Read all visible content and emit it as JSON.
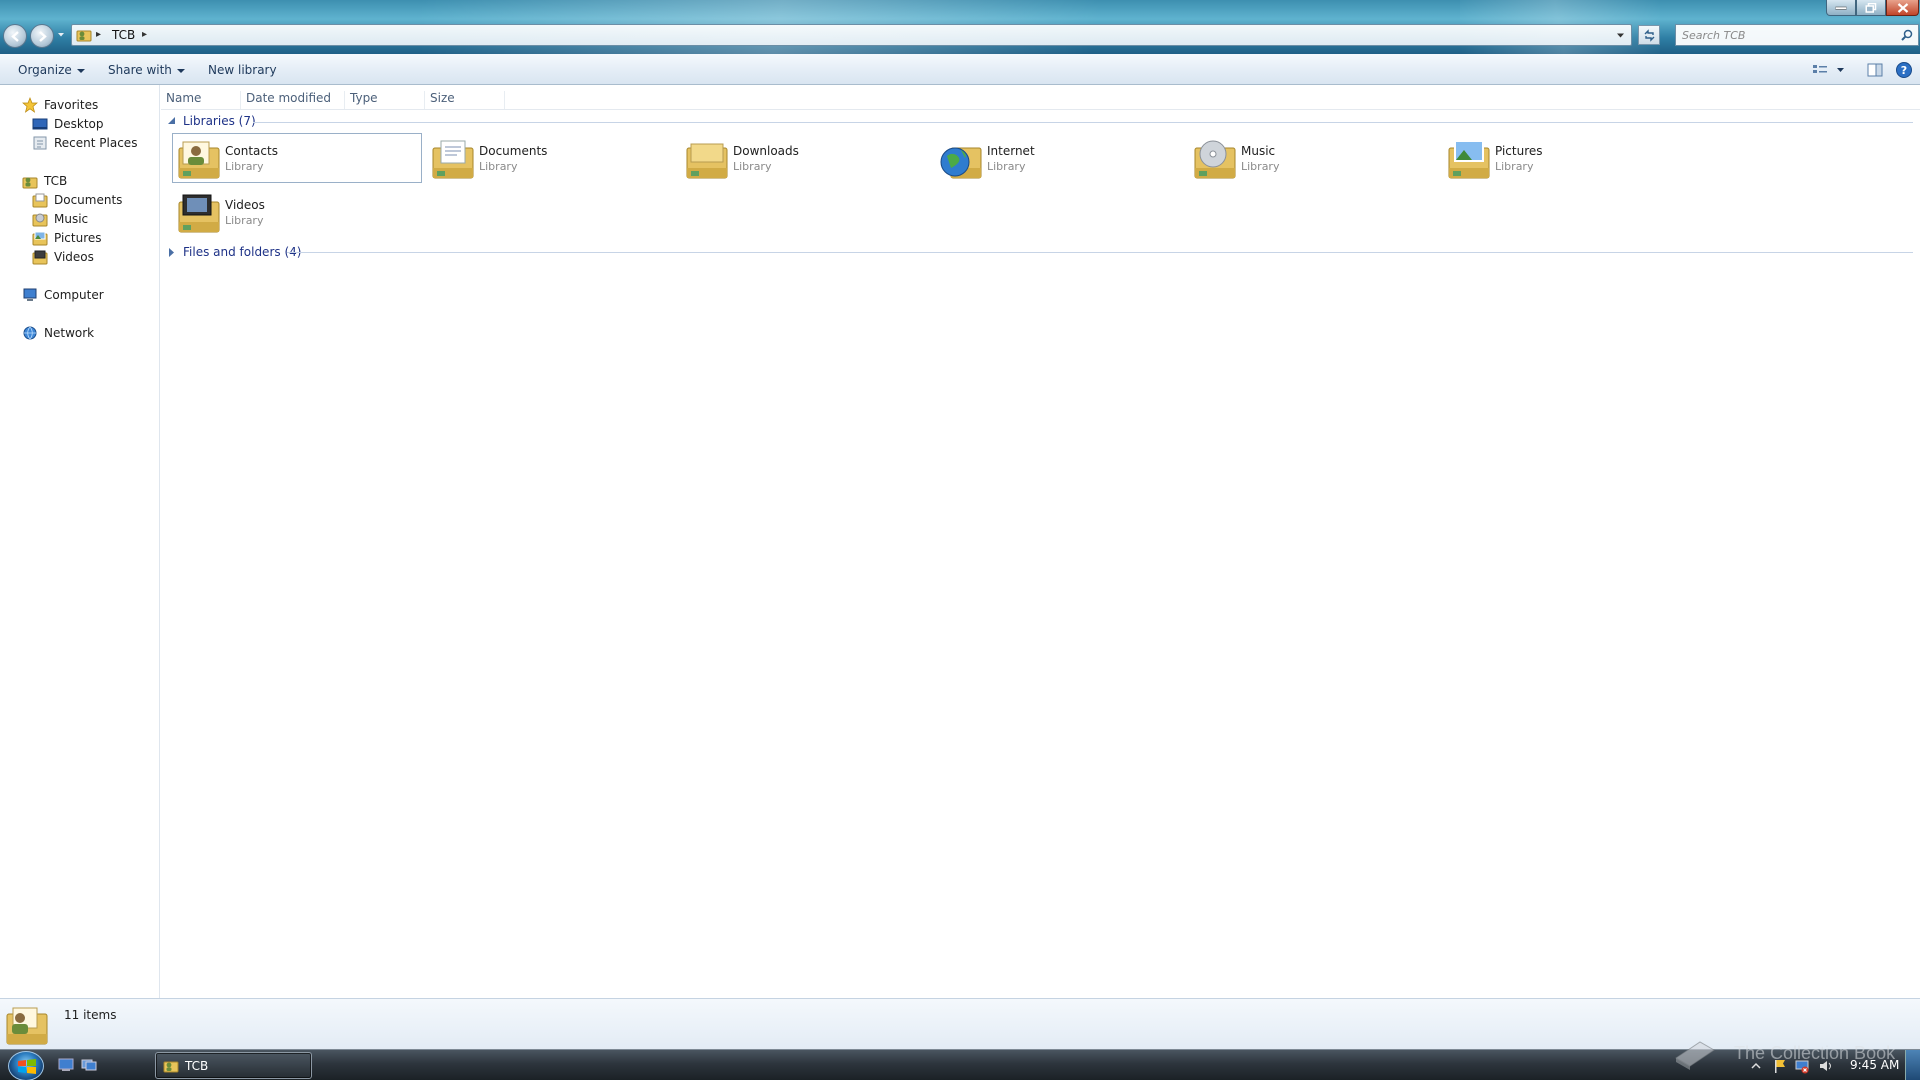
{
  "window": {
    "address": {
      "crumb": "TCB"
    },
    "search": {
      "placeholder": "Search TCB"
    }
  },
  "toolbar": {
    "organize": "Organize",
    "share_with": "Share with",
    "new_library": "New library"
  },
  "navigation": {
    "favorites": {
      "label": "Favorites",
      "items": [
        {
          "label": "Desktop",
          "icon": "desktop-icon"
        },
        {
          "label": "Recent Places",
          "icon": "recent-places-icon"
        }
      ]
    },
    "user": {
      "label": "TCB",
      "items": [
        {
          "label": "Documents",
          "icon": "documents-library-icon"
        },
        {
          "label": "Music",
          "icon": "music-library-icon"
        },
        {
          "label": "Pictures",
          "icon": "pictures-library-icon"
        },
        {
          "label": "Videos",
          "icon": "videos-library-icon"
        }
      ]
    },
    "computer": "Computer",
    "network": "Network"
  },
  "columns": [
    "Name",
    "Date modified",
    "Type",
    "Size"
  ],
  "groups": {
    "libraries": "Libraries (7)",
    "files_and_folders": "Files and folders (4)"
  },
  "libraries": [
    {
      "name": "Contacts",
      "sub": "Library",
      "icon": "contacts-library-icon",
      "selected": true
    },
    {
      "name": "Documents",
      "sub": "Library",
      "icon": "documents-library-icon",
      "selected": false
    },
    {
      "name": "Downloads",
      "sub": "Library",
      "icon": "downloads-library-icon",
      "selected": false
    },
    {
      "name": "Internet",
      "sub": "Library",
      "icon": "internet-library-icon",
      "selected": false
    },
    {
      "name": "Music",
      "sub": "Library",
      "icon": "music-library-icon",
      "selected": false
    },
    {
      "name": "Pictures",
      "sub": "Library",
      "icon": "pictures-library-icon",
      "selected": false
    },
    {
      "name": "Videos",
      "sub": "Library",
      "icon": "videos-library-icon",
      "selected": false
    }
  ],
  "details": {
    "count": "11 items"
  },
  "taskbar": {
    "window_button": "TCB",
    "clock": "9:45 AM",
    "watermark": "The Collection Book"
  },
  "colors": {
    "group_header": "#1e3287",
    "command_text": "#1e395b",
    "selection_border": "#9ab0c8"
  }
}
